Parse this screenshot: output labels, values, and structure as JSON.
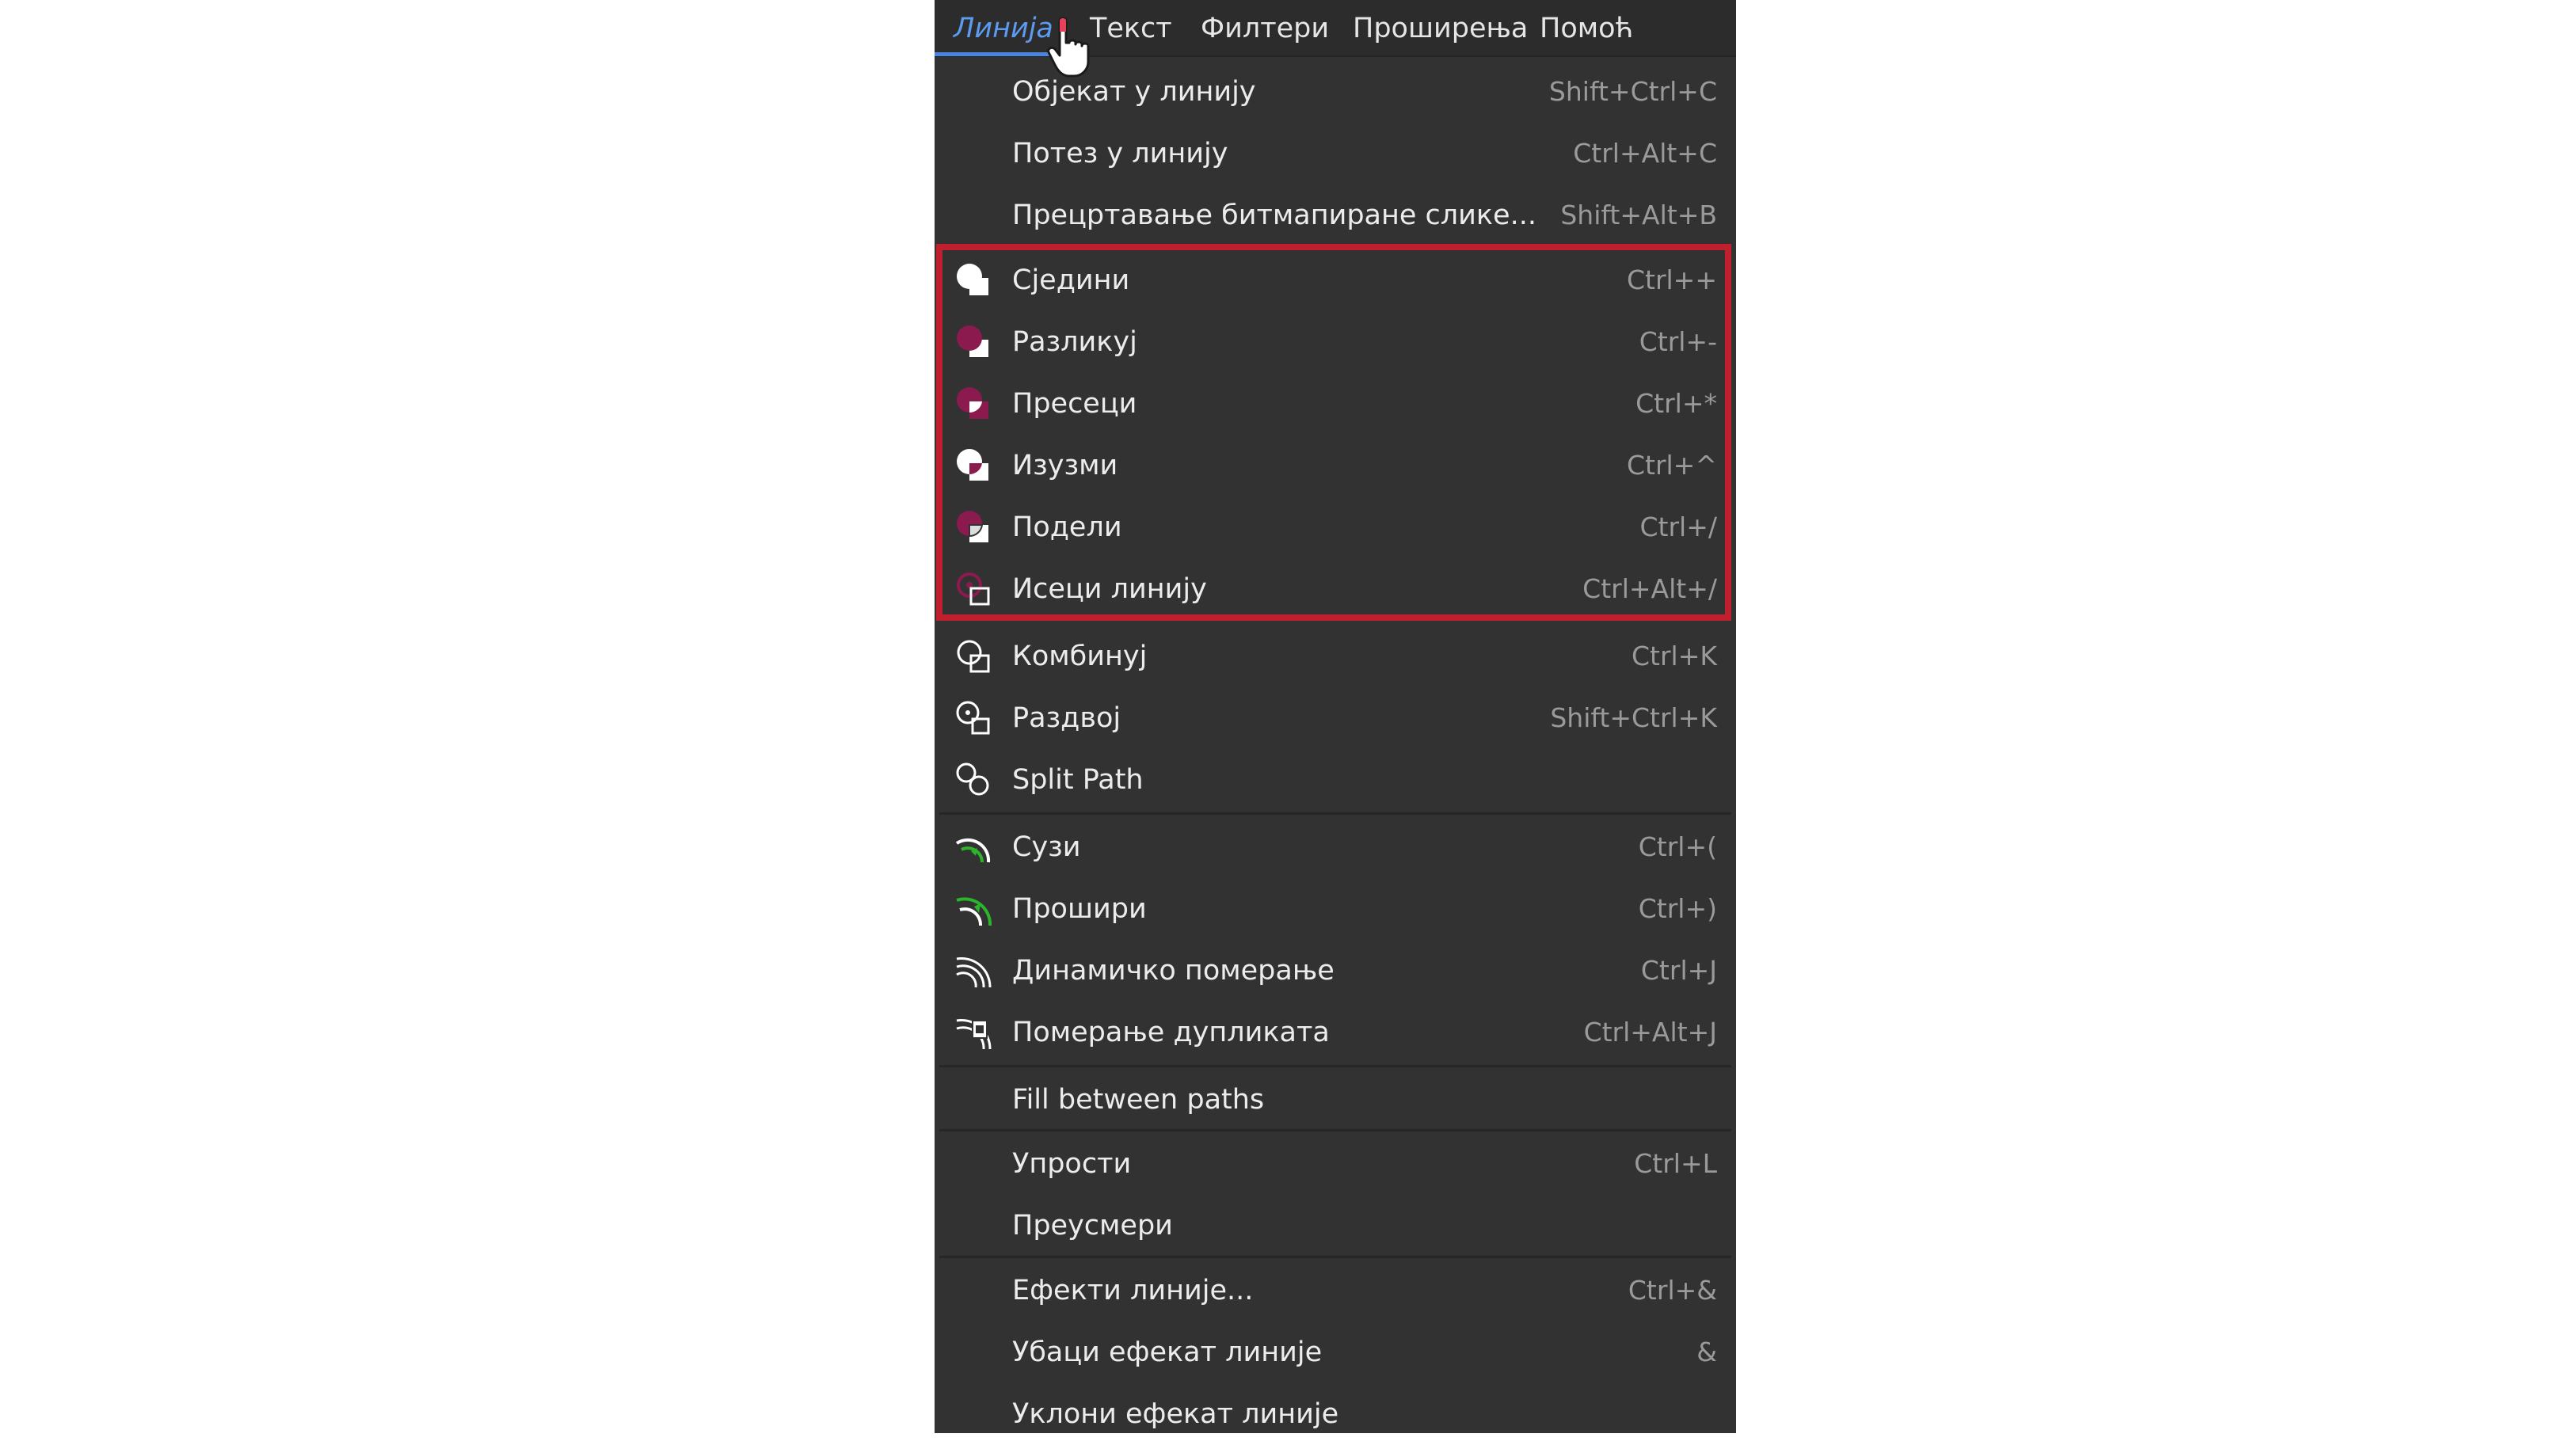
{
  "menubar": {
    "items": [
      {
        "label": "Линија",
        "active": true
      },
      {
        "label": "Текст"
      },
      {
        "label": "Филтери"
      },
      {
        "label": "Проширења"
      },
      {
        "label": "Помоћ"
      }
    ]
  },
  "menu": {
    "items": [
      {
        "label": "Објекат у линију",
        "shortcut": "Shift+Ctrl+C",
        "icon": ""
      },
      {
        "label": "Потез у линију",
        "shortcut": "Ctrl+Alt+C",
        "icon": ""
      },
      {
        "label": "Прецртавање битмапиране слике...",
        "shortcut": "Shift+Alt+B",
        "icon": ""
      },
      {
        "label": "Сједини",
        "shortcut": "Ctrl++",
        "icon": "path-union-icon"
      },
      {
        "label": "Разликуј",
        "shortcut": "Ctrl+-",
        "icon": "path-difference-icon"
      },
      {
        "label": "Пресеци",
        "shortcut": "Ctrl+*",
        "icon": "path-intersection-icon"
      },
      {
        "label": "Изузми",
        "shortcut": "Ctrl+^",
        "icon": "path-exclusion-icon"
      },
      {
        "label": "Подели",
        "shortcut": "Ctrl+/",
        "icon": "path-division-icon"
      },
      {
        "label": "Исеци линију",
        "shortcut": "Ctrl+Alt+/",
        "icon": "path-cut-icon"
      },
      {
        "label": "Комбинуј",
        "shortcut": "Ctrl+K",
        "icon": "path-combine-icon"
      },
      {
        "label": "Раздвој",
        "shortcut": "Shift+Ctrl+K",
        "icon": "path-break-apart-icon"
      },
      {
        "label": "Split Path",
        "shortcut": "",
        "icon": "path-split-icon"
      },
      {
        "label": "Сузи",
        "shortcut": "Ctrl+(",
        "icon": "path-inset-icon"
      },
      {
        "label": "Прошири",
        "shortcut": "Ctrl+)",
        "icon": "path-outset-icon"
      },
      {
        "label": "Динамичко померање",
        "shortcut": "Ctrl+J",
        "icon": "dynamic-offset-icon"
      },
      {
        "label": "Померање дупликата",
        "shortcut": "Ctrl+Alt+J",
        "icon": "linked-offset-icon"
      },
      {
        "label": "Fill between paths",
        "shortcut": "",
        "icon": ""
      },
      {
        "label": "Упрости",
        "shortcut": "Ctrl+L",
        "icon": ""
      },
      {
        "label": "Преусмери",
        "shortcut": "",
        "icon": ""
      },
      {
        "label": "Ефекти линије...",
        "shortcut": "Ctrl+&",
        "icon": ""
      },
      {
        "label": "Убаци ефекат линије",
        "shortcut": "&",
        "icon": ""
      },
      {
        "label": "Уклони ефекат линије",
        "shortcut": "",
        "icon": ""
      }
    ]
  },
  "colors": {
    "background": "#323232",
    "text": "#ececec",
    "shortcut": "#9a9a9a",
    "active_menu": "#5b9bf0",
    "highlight": "#c0202e",
    "icon_accent": "#8b1a4e",
    "icon_green": "#2bb52b"
  }
}
